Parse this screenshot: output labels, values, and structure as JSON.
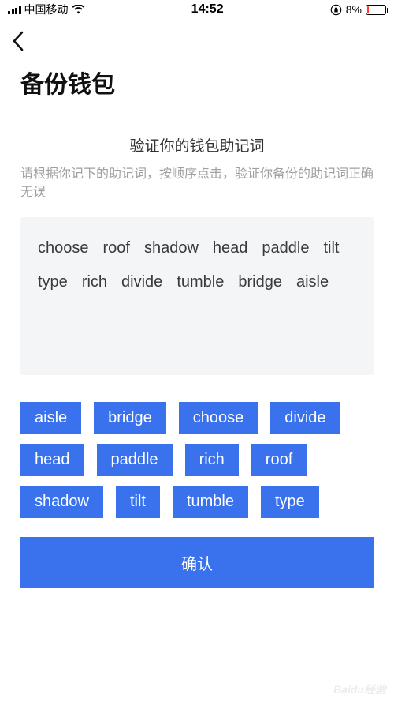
{
  "status": {
    "carrier": "中国移动",
    "time": "14:52",
    "battery_pct": "8%"
  },
  "page": {
    "title": "备份钱包",
    "subtitle": "验证你的钱包助记词",
    "instruction": "请根据你记下的助记词，按顺序点击，验证你备份的助记词正确无误",
    "confirm_label": "确认"
  },
  "selected_words": [
    "choose",
    "roof",
    "shadow",
    "head",
    "paddle",
    "tilt",
    "type",
    "rich",
    "divide",
    "tumble",
    "bridge",
    "aisle"
  ],
  "word_pool": [
    "aisle",
    "bridge",
    "choose",
    "divide",
    "head",
    "paddle",
    "rich",
    "roof",
    "shadow",
    "tilt",
    "tumble",
    "type"
  ],
  "watermark": "Baidu经验"
}
